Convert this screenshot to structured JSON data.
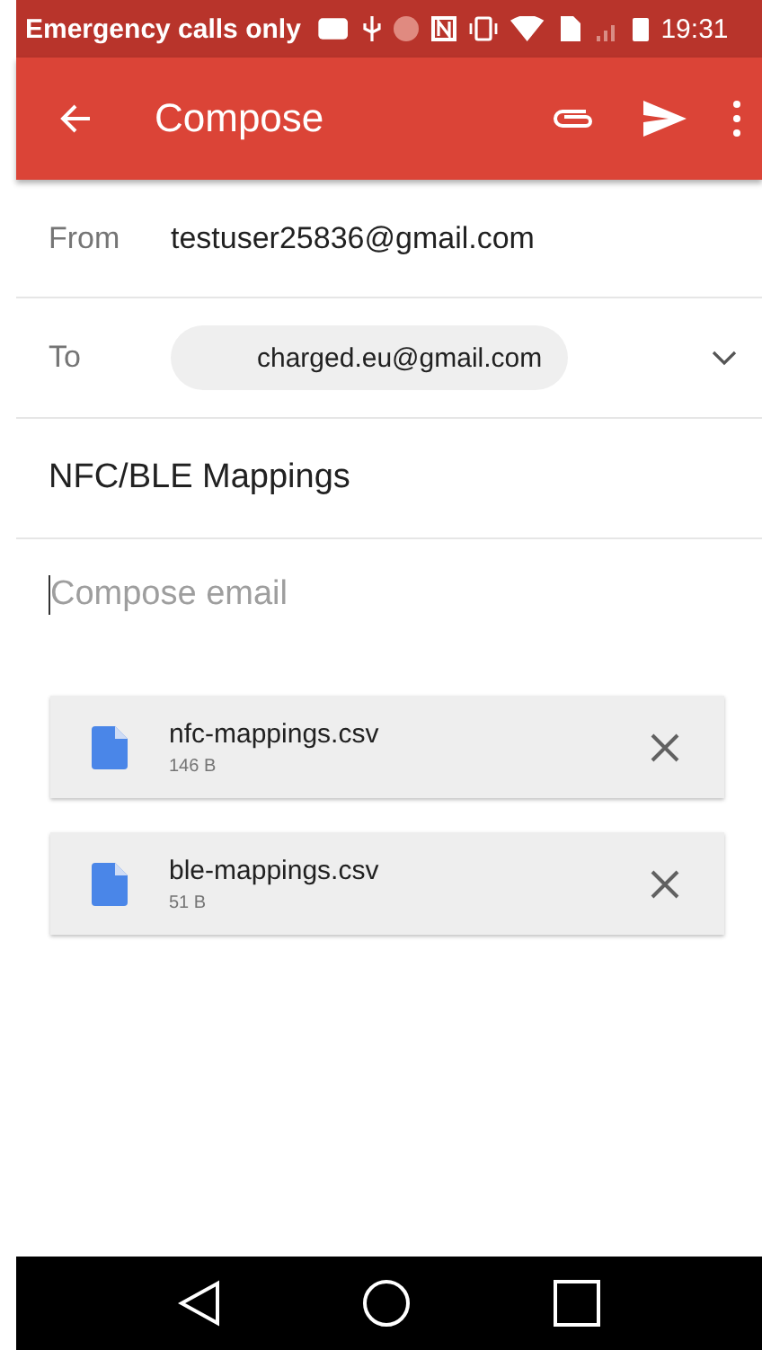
{
  "status_bar": {
    "carrier": "Emergency calls only",
    "time": "19:31"
  },
  "app_bar": {
    "title": "Compose"
  },
  "from": {
    "label": "From",
    "value": "testuser25836@gmail.com"
  },
  "to": {
    "label": "To",
    "recipients": [
      "charged.eu@gmail.com"
    ]
  },
  "subject": {
    "value": "NFC/BLE Mappings"
  },
  "body": {
    "placeholder": "Compose email"
  },
  "attachments": [
    {
      "name": "nfc-mappings.csv",
      "size": "146 B"
    },
    {
      "name": "ble-mappings.csv",
      "size": "51 B"
    }
  ]
}
